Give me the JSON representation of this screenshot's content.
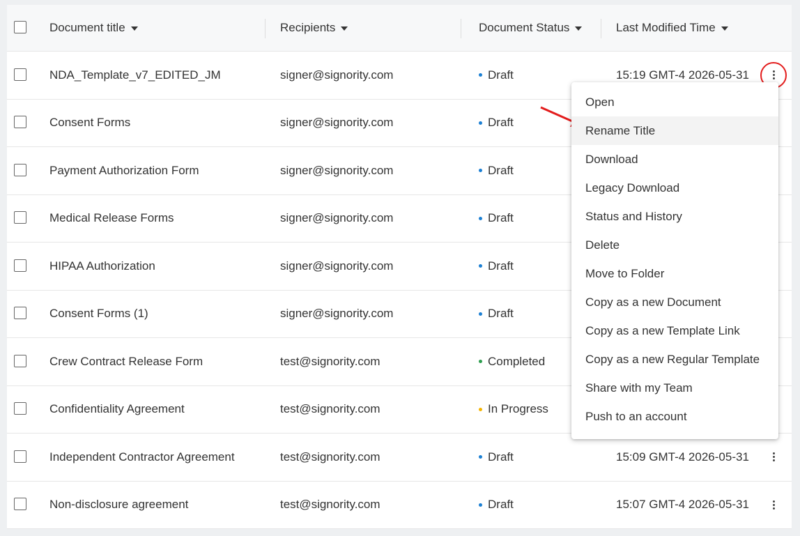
{
  "header": {
    "title_label": "Document title",
    "recipients_label": "Recipients",
    "status_label": "Document Status",
    "time_label": "Last Modified Time"
  },
  "colors": {
    "draft": "#1b7fd3",
    "completed": "#2e9e4f",
    "in_progress": "#f5b400",
    "annotation": "#e31c1c"
  },
  "rows": [
    {
      "title": "NDA_Template_v7_EDITED_JM",
      "recipient": "signer@signority.com",
      "status": "Draft",
      "status_color": "#1b7fd3",
      "time": "15:19 GMT-4 2026-05-31"
    },
    {
      "title": "Consent Forms",
      "recipient": "signer@signority.com",
      "status": "Draft",
      "status_color": "#1b7fd3",
      "time": ""
    },
    {
      "title": "Payment Authorization Form",
      "recipient": "signer@signority.com",
      "status": "Draft",
      "status_color": "#1b7fd3",
      "time": ""
    },
    {
      "title": "Medical Release Forms",
      "recipient": "signer@signority.com",
      "status": "Draft",
      "status_color": "#1b7fd3",
      "time": ""
    },
    {
      "title": "HIPAA Authorization",
      "recipient": "signer@signority.com",
      "status": "Draft",
      "status_color": "#1b7fd3",
      "time": ""
    },
    {
      "title": "Consent Forms (1)",
      "recipient": "signer@signority.com",
      "status": "Draft",
      "status_color": "#1b7fd3",
      "time": ""
    },
    {
      "title": "Crew Contract Release Form",
      "recipient": "test@signority.com",
      "status": "Completed",
      "status_color": "#2e9e4f",
      "time": ""
    },
    {
      "title": "Confidentiality Agreement",
      "recipient": "test@signority.com",
      "status": "In Progress",
      "status_color": "#f5b400",
      "time": ""
    },
    {
      "title": "Independent Contractor Agreement",
      "recipient": "test@signority.com",
      "status": "Draft",
      "status_color": "#1b7fd3",
      "time": "15:09 GMT-4 2026-05-31"
    },
    {
      "title": "Non-disclosure agreement",
      "recipient": "test@signority.com",
      "status": "Draft",
      "status_color": "#1b7fd3",
      "time": "15:07 GMT-4 2026-05-31"
    }
  ],
  "context_menu": {
    "items": [
      "Open",
      "Rename Title",
      "Download",
      "Legacy Download",
      "Status and History",
      "Delete",
      "Move to Folder",
      "Copy as a new Document",
      "Copy as a new Template Link",
      "Copy as a new Regular Template",
      "Share with my Team",
      "Push to an account"
    ],
    "highlighted": "Rename Title"
  }
}
